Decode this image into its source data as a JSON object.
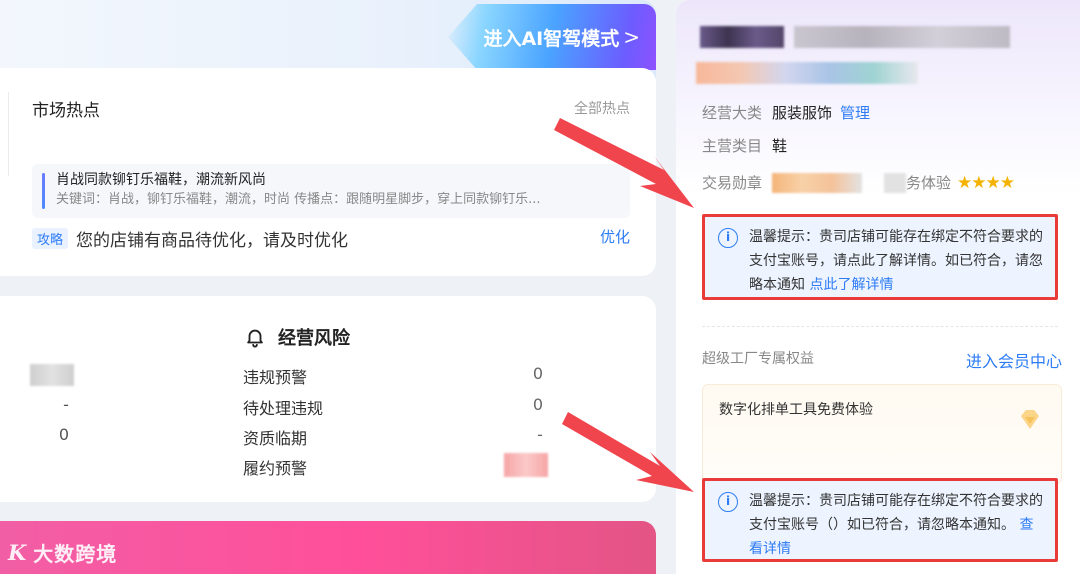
{
  "top_banner": {
    "ai_mode_label": "进入AI智驾模式",
    "chevron": ">"
  },
  "market": {
    "title": "市场热点",
    "all_link": "全部热点",
    "hot_item": {
      "title": "肖战同款铆钉乐福鞋，潮流新风尚",
      "keywords": "关键词：肖战，铆钉乐福鞋，潮流，时尚 传播点：跟随明星脚步，穿上同款铆钉乐..."
    },
    "strategy_tag": "攻略",
    "strategy_text": "您的店铺有商品待优化，请及时优化",
    "optimize_link": "优化"
  },
  "risk": {
    "title": "经营风险",
    "rows": [
      {
        "left_value": "",
        "label": "违规预警",
        "value": "0"
      },
      {
        "left_value": "-",
        "label": "待处理违规",
        "value": "0"
      },
      {
        "left_value": "0",
        "label": "资质临期",
        "value": "-"
      },
      {
        "left_value": "",
        "label": "履约预警",
        "value": ""
      }
    ]
  },
  "watermark": {
    "logo": "K",
    "text": "大数跨境"
  },
  "shop": {
    "category_label": "经营大类",
    "category_value": "服装服饰",
    "manage_link": "管理",
    "main_cat_label": "主营类目",
    "main_cat_value": "鞋",
    "badge_label": "交易勋章",
    "service_label": "务体验",
    "stars": "★★★★"
  },
  "tip1": {
    "prefix": "温馨提示：贵司店铺可能存在绑定不符合要求的支付宝账号，请点此了解详情。如已符合，请忽略本通知",
    "link": "点此了解详情"
  },
  "member": {
    "title": "超级工厂专属权益",
    "link": "进入会员中心",
    "benefit": "数字化排单工具免费体验"
  },
  "tip2": {
    "prefix": "温馨提示：贵司店铺可能存在绑定不符合要求的支付宝账号（）如已符合，请忽略本通知。",
    "link": "查看详情"
  },
  "colors": {
    "accent_blue": "#2e7cf6",
    "highlight_red": "#ea3b3b",
    "star_gold": "#f5b301",
    "banner_pink": "#ff4f9a"
  }
}
